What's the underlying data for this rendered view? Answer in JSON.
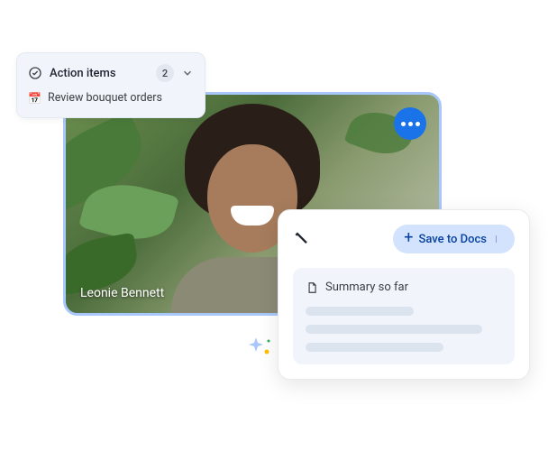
{
  "video": {
    "participant_name": "Leonie Bennett",
    "more_icon": "more-horizontal"
  },
  "action_items": {
    "check_icon": "check-circle",
    "title": "Action items",
    "count": "2",
    "chevron_icon": "chevron-down",
    "items": [
      {
        "icon": "📅",
        "label": "Review bouquet orders"
      }
    ]
  },
  "summary": {
    "pencil_icon": "magic-pencil",
    "save_plus": "+",
    "save_label": "Save to Docs",
    "dropdown_icon": "caret-down",
    "doc_icon": "document",
    "label": "Summary so far"
  },
  "colors": {
    "accent": "#1a73e8",
    "pill": "#d3e3fd",
    "pill_text": "#0842a0",
    "panel": "#f1f5fb"
  }
}
